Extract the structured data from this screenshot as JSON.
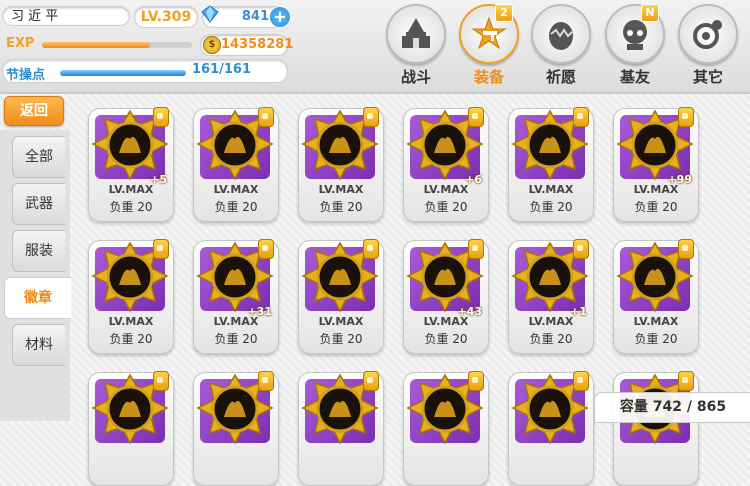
{
  "player": {
    "name": "习 近 平",
    "level": "LV.309",
    "gems": "841",
    "exp_label": "EXP",
    "exp_fraction": 0.72,
    "gold": "14358281",
    "stamina_label": "节操点",
    "stamina": "161/161",
    "stamina_fraction": 1.0
  },
  "nav": [
    {
      "label": "战斗",
      "icon": "castle-icon",
      "badge": ""
    },
    {
      "label": "装备",
      "icon": "star-gun-icon",
      "badge": "2",
      "active": true
    },
    {
      "label": "祈愿",
      "icon": "egg-icon",
      "badge": ""
    },
    {
      "label": "基友",
      "icon": "character-icon",
      "badge": "N"
    },
    {
      "label": "其它",
      "icon": "camera-gear-icon",
      "badge": ""
    }
  ],
  "sidebar": {
    "back": "返回",
    "tabs": [
      "全部",
      "武器",
      "服装",
      "徽章",
      "材料"
    ],
    "active": "徽章"
  },
  "cards": [
    {
      "lv": "LV.MAX",
      "weight": "负重 20",
      "bonus": "+5"
    },
    {
      "lv": "LV.MAX",
      "weight": "负重 20",
      "bonus": ""
    },
    {
      "lv": "LV.MAX",
      "weight": "负重 20",
      "bonus": ""
    },
    {
      "lv": "LV.MAX",
      "weight": "负重 20",
      "bonus": "+6"
    },
    {
      "lv": "LV.MAX",
      "weight": "负重 20",
      "bonus": ""
    },
    {
      "lv": "LV.MAX",
      "weight": "负重 20",
      "bonus": "+99"
    },
    {
      "lv": "LV.MAX",
      "weight": "负重 20",
      "bonus": ""
    },
    {
      "lv": "LV.MAX",
      "weight": "负重 20",
      "bonus": "+31"
    },
    {
      "lv": "LV.MAX",
      "weight": "负重 20",
      "bonus": ""
    },
    {
      "lv": "LV.MAX",
      "weight": "负重 20",
      "bonus": "+43"
    },
    {
      "lv": "LV.MAX",
      "weight": "负重 20",
      "bonus": "+1"
    },
    {
      "lv": "LV.MAX",
      "weight": "负重 20",
      "bonus": ""
    },
    {
      "lv": "",
      "weight": "",
      "bonus": ""
    },
    {
      "lv": "",
      "weight": "",
      "bonus": ""
    },
    {
      "lv": "",
      "weight": "",
      "bonus": ""
    },
    {
      "lv": "",
      "weight": "",
      "bonus": ""
    },
    {
      "lv": "",
      "weight": "",
      "bonus": ""
    },
    {
      "lv": "",
      "weight": "",
      "bonus": ""
    }
  ],
  "capacity": "容量 742 / 865",
  "colors": {
    "accent": "#f08c1a",
    "blue": "#2a8fd6",
    "purple": "#8a3dc0",
    "gold": "#e8b020"
  }
}
